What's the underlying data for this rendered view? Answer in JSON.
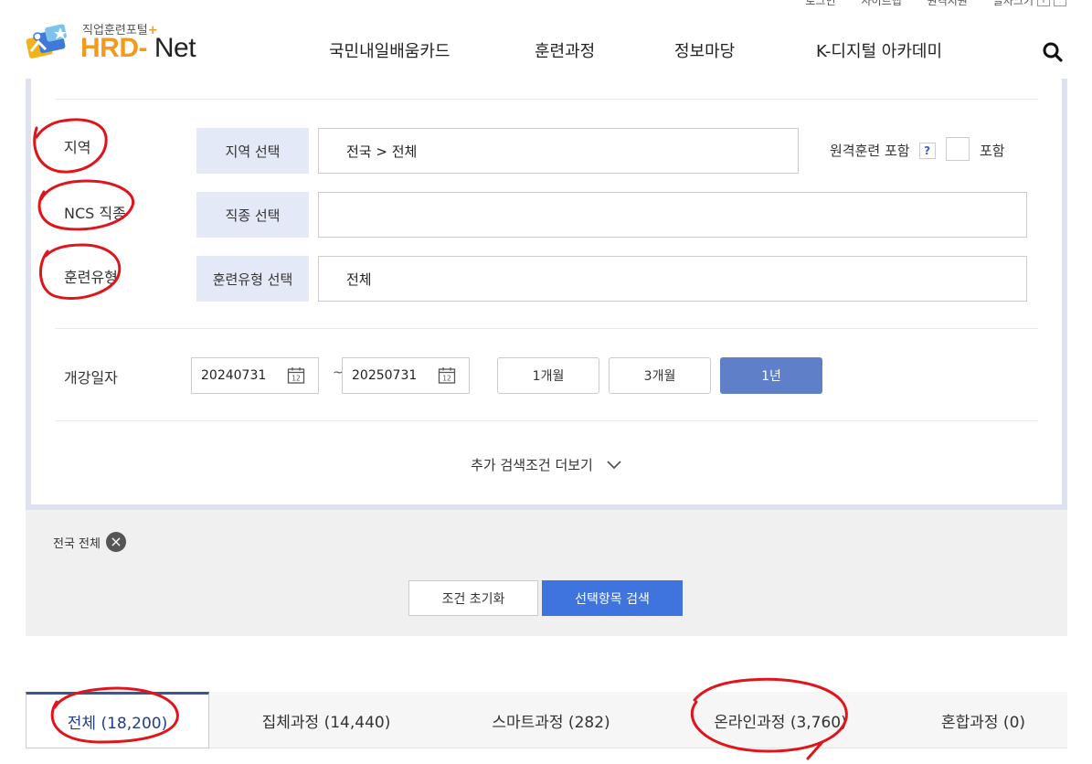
{
  "utility": {
    "items": [
      "로그인",
      "사이트맵",
      "원격지원",
      "글자크기"
    ],
    "plus": "+",
    "minus": "−"
  },
  "logo": {
    "subtitle": "직업훈련포털",
    "plus": "+",
    "hrd": "HRD",
    "dash": "-",
    "net": "Net"
  },
  "gnb": {
    "items": [
      "국민내일배움카드",
      "훈련과정",
      "정보마당",
      "K-디지털 아카데미"
    ]
  },
  "search": {
    "region": {
      "label": "지역",
      "button": "지역 선택",
      "value": "전국 > 전체"
    },
    "remote": {
      "label": "원격훈련 포함",
      "help": "?",
      "checkbox_label": "포함"
    },
    "ncs": {
      "label": "NCS 직종",
      "button": "직종 선택",
      "value": ""
    },
    "type": {
      "label": "훈련유형",
      "button": "훈련유형 선택",
      "value": "전체"
    },
    "date": {
      "label": "개강일자",
      "start": "20240731",
      "end": "20250731",
      "tilde": "~",
      "cal": "12"
    },
    "periods": [
      {
        "label": "1개월",
        "active": false
      },
      {
        "label": "3개월",
        "active": false
      },
      {
        "label": "1년",
        "active": true
      }
    ],
    "more_label": "추가 검색조건 더보기"
  },
  "summary": {
    "chip_label": "전국 전체",
    "reset_label": "조건 초기화",
    "search_label": "선택항목 검색"
  },
  "tabs": [
    {
      "label": "전체 (18,200)",
      "active": true
    },
    {
      "label": "집체과정 (14,440)",
      "active": false
    },
    {
      "label": "스마트과정 (282)",
      "active": false
    },
    {
      "label": "온라인과정 (3,760)",
      "active": false
    },
    {
      "label": "혼합과정 (0)",
      "active": false
    }
  ],
  "colors": {
    "accent": "#3f74df",
    "period_active": "#5f7fc8",
    "annotation": "#e0141b",
    "logo_orange": "#f39a1c"
  }
}
